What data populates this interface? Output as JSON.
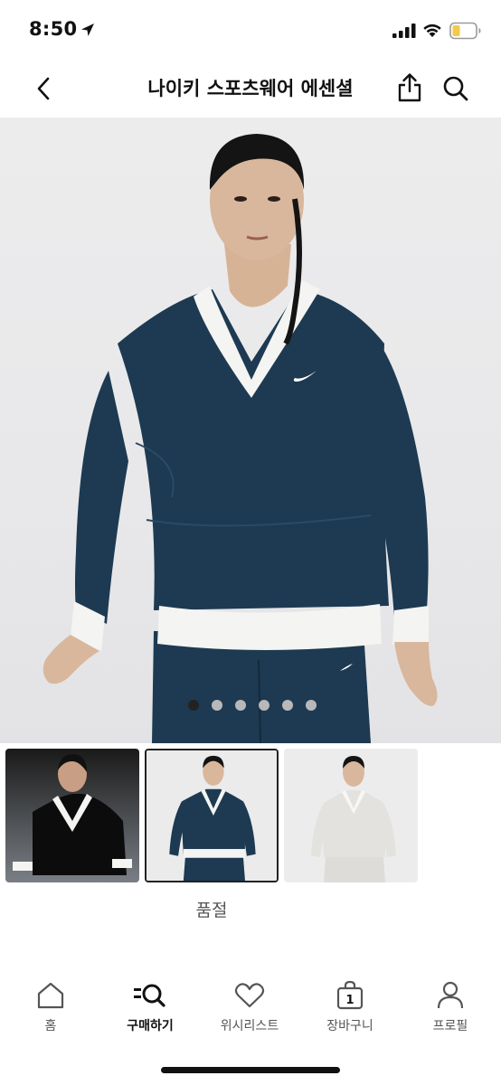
{
  "status_bar": {
    "time": "8:50",
    "icons": [
      "location-arrow-icon",
      "cellular-signal-icon",
      "wifi-icon",
      "battery-icon"
    ]
  },
  "nav": {
    "title": "나이키 스포츠웨어 에센셜",
    "back_icon": "chevron-left-icon",
    "share_icon": "share-icon",
    "search_icon": "search-icon"
  },
  "product": {
    "image_count": 6,
    "active_image_index": 0,
    "colors": {
      "jacket": "#1d3a52",
      "trim": "#f4f4f2",
      "background": "#ececed"
    }
  },
  "variants": {
    "items": [
      {
        "color_name": "black",
        "swatch": "#101010",
        "selected": false
      },
      {
        "color_name": "navy",
        "swatch": "#1d3a52",
        "selected": true
      },
      {
        "color_name": "white",
        "swatch": "#ecebe8",
        "selected": false
      }
    ],
    "sold_out_label": "품절"
  },
  "tab_bar": {
    "tabs": [
      {
        "label": "홈",
        "icon": "home-icon",
        "active": false
      },
      {
        "label": "구매하기",
        "icon": "search-menu-icon",
        "active": true
      },
      {
        "label": "위시리스트",
        "icon": "heart-icon",
        "active": false
      },
      {
        "label": "장바구니",
        "icon": "bag-icon",
        "badge": "1",
        "active": false
      },
      {
        "label": "프로필",
        "icon": "profile-icon",
        "active": false
      }
    ]
  }
}
